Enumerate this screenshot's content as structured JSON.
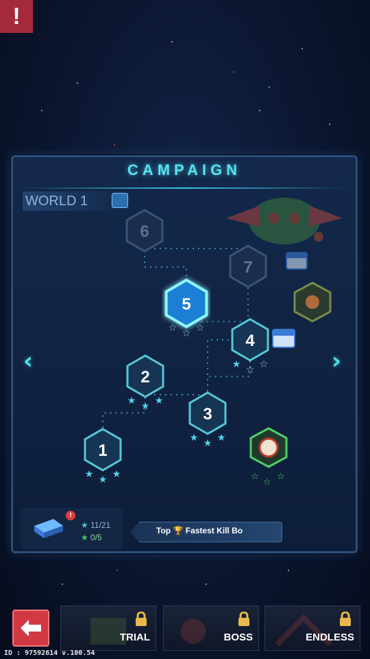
{
  "alert_icon": "!",
  "panel": {
    "title": "CAMPAIGN",
    "world_label": "WORLD 1",
    "world_icon": "book-icon"
  },
  "stages": [
    {
      "number": "1",
      "state": "cleared",
      "stars": 3
    },
    {
      "number": "2",
      "state": "cleared",
      "stars": 3
    },
    {
      "number": "3",
      "state": "cleared",
      "stars": 3
    },
    {
      "number": "4",
      "state": "cleared",
      "stars": 1
    },
    {
      "number": "5",
      "state": "current",
      "stars": 0
    },
    {
      "number": "6",
      "state": "locked",
      "stars": 0
    },
    {
      "number": "7",
      "state": "locked",
      "stars": 0
    }
  ],
  "nav": {
    "prev": "‹",
    "next": "›"
  },
  "progress": {
    "stars": "11/21",
    "green_stars": "0/5"
  },
  "leaderboard": {
    "prefix": "Top",
    "rest": "Fastest Kill Bo"
  },
  "modes": [
    {
      "label": "TRIAL",
      "locked": true
    },
    {
      "label": "BOSS",
      "locked": true
    },
    {
      "label": "ENDLESS",
      "locked": true
    }
  ],
  "version": "ID : 97592614  v.100.54",
  "colors": {
    "accent": "#58e3f0",
    "back_button": "#d23842",
    "alert": "#a3293b"
  }
}
